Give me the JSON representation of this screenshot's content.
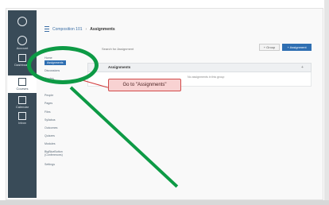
{
  "breadcrumb": {
    "course": "Composition 101",
    "current": "Assignments"
  },
  "toolbar": {
    "search_placeholder": "Search for Assignment",
    "view_label": "+ Group",
    "add_label": "+ Assignment"
  },
  "global_nav": {
    "items": [
      {
        "label": "",
        "icon": "logo-icon"
      },
      {
        "label": "Account",
        "icon": "account-icon"
      },
      {
        "label": "Dashboard",
        "icon": "dashboard-icon"
      },
      {
        "label": "Courses",
        "icon": "courses-icon"
      },
      {
        "label": "Calendar",
        "icon": "calendar-icon"
      },
      {
        "label": "Inbox",
        "icon": "inbox-icon"
      }
    ]
  },
  "course_nav": {
    "items": [
      "Home",
      "Assignments",
      "Discussions",
      "Grades",
      "People",
      "Pages",
      "Files",
      "Syllabus",
      "Outcomes",
      "Quizzes",
      "Modules",
      "BigBlueButton (Conferences)",
      "Settings"
    ]
  },
  "assignment_group": {
    "title": "Assignments",
    "weight": "",
    "row_text": "No assignments in this group"
  },
  "tooltip": {
    "text": "Go to \"Assignments\""
  },
  "colors": {
    "nav_bg": "#394b58",
    "accent": "#2f6fb2",
    "annotation_green": "#0d9a45",
    "tooltip_red": "#d24b4b"
  }
}
